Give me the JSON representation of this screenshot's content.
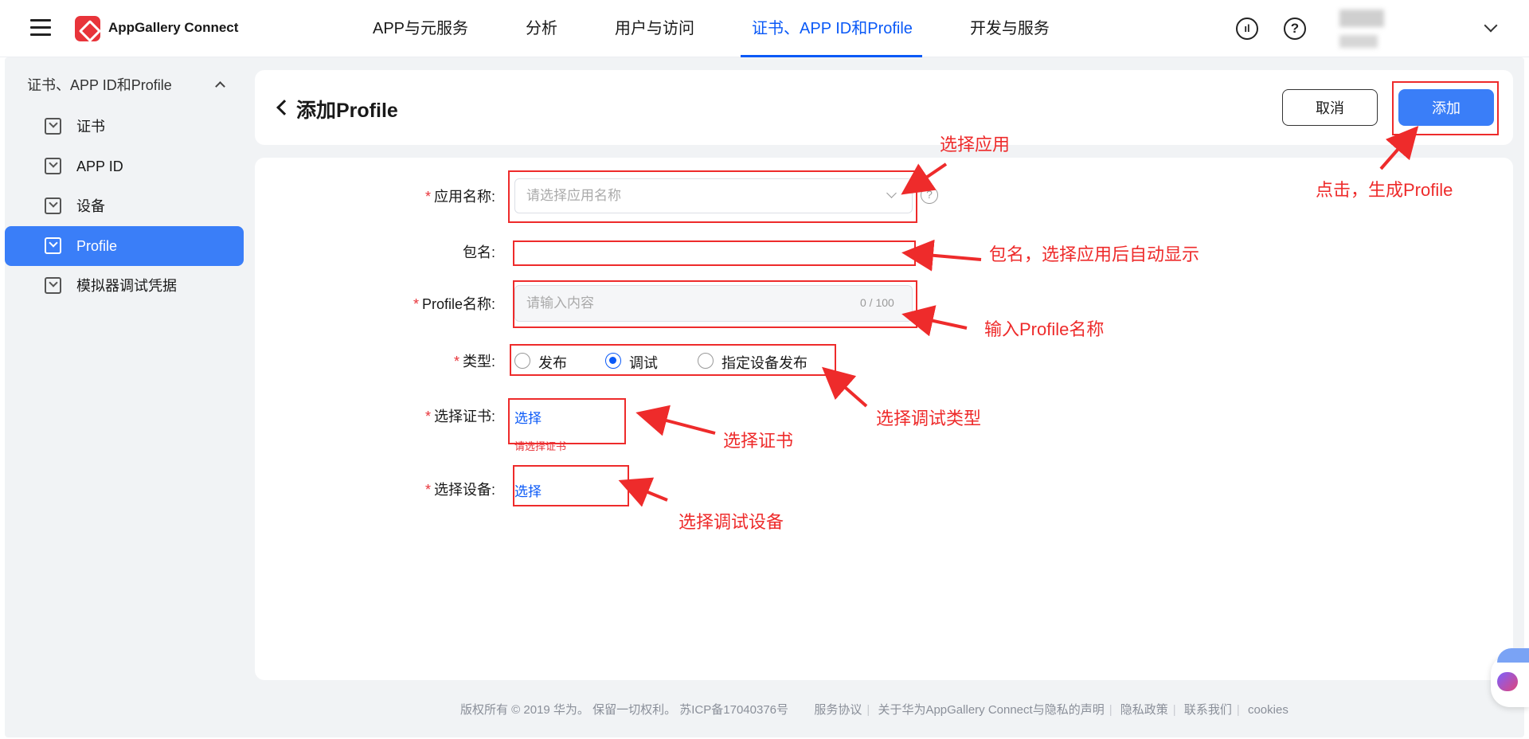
{
  "header": {
    "brand": "AppGallery Connect",
    "nav": [
      {
        "label": "APP与元服务",
        "active": false
      },
      {
        "label": "分析",
        "active": false
      },
      {
        "label": "用户与访问",
        "active": false
      },
      {
        "label": "证书、APP ID和Profile",
        "active": true
      },
      {
        "label": "开发与服务",
        "active": false
      }
    ],
    "help_glyph": "?",
    "feedback_glyph": "ıl"
  },
  "sidebar": {
    "group": "证书、APP ID和Profile",
    "items": [
      {
        "label": "证书",
        "active": false
      },
      {
        "label": "APP ID",
        "active": false
      },
      {
        "label": "设备",
        "active": false
      },
      {
        "label": "Profile",
        "active": true
      },
      {
        "label": "模拟器调试凭据",
        "active": false
      }
    ]
  },
  "page": {
    "title": "添加Profile",
    "cancel_label": "取消",
    "add_label": "添加"
  },
  "form": {
    "required_mark": "*",
    "app_name_label": "应用名称:",
    "app_name_placeholder": "请选择应用名称",
    "help_glyph": "?",
    "package_label": "包名:",
    "package_value": "",
    "profile_name_label": "Profile名称:",
    "profile_name_placeholder": "请输入内容",
    "profile_name_counter": "0 / 100",
    "type_label": "类型:",
    "type_options": [
      {
        "label": "发布",
        "checked": false
      },
      {
        "label": "调试",
        "checked": true
      },
      {
        "label": "指定设备发布",
        "checked": false
      }
    ],
    "cert_label": "选择证书:",
    "cert_link": "选择",
    "cert_error": "请选择证书",
    "device_label": "选择设备:",
    "device_link": "选择"
  },
  "annotations": {
    "select_app": "选择应用",
    "click_generate": "点击，生成Profile",
    "package_hint": "包名，选择应用后自动显示",
    "enter_name": "输入Profile名称",
    "select_type": "选择调试类型",
    "select_cert": "选择证书",
    "select_device": "选择调试设备",
    "color": "#ee2b2b"
  },
  "footer": {
    "copyright": "版权所有 © 2019 华为。 保留一切权利。 苏ICP备17040376号",
    "links": [
      "服务协议",
      "关于华为AppGallery Connect与隐私的声明",
      "隐私政策",
      "联系我们",
      "cookies"
    ]
  },
  "colors": {
    "primary": "#0a59f7",
    "button_blue": "#3a7ef8",
    "brand_red": "#e8343a"
  }
}
